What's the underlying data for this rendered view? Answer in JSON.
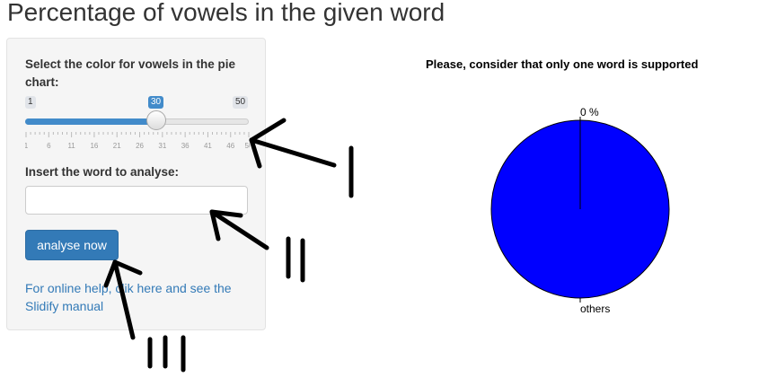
{
  "page": {
    "title": "Percentage of vowels in the given word"
  },
  "sidebar": {
    "color_label": "Select the color for vowels in the pie chart:",
    "slider": {
      "min": "1",
      "max": "50",
      "value": "30",
      "tick_labels": [
        "1",
        "6",
        "11",
        "16",
        "21",
        "26",
        "31",
        "36",
        "41",
        "46",
        "50"
      ]
    },
    "word_label": "Insert the word to analyse:",
    "word_input": {
      "value": "",
      "placeholder": ""
    },
    "analyse_button": "analyse now",
    "help_text": "For online help, clik here and see the Slidify manual"
  },
  "chart": {
    "title": "Please, consider that only one word is supported",
    "slice_top_label": "0 %",
    "slice_bottom_label": "others",
    "fill_color": "#0000ff"
  },
  "chart_data": {
    "type": "pie",
    "title": "Please, consider that only one word is supported",
    "labels": [
      "0 %",
      "others"
    ],
    "values": [
      0,
      100
    ],
    "colors": [
      "#0000ff",
      "#0000ff"
    ]
  },
  "annotations": {
    "arrow_labels": [
      "I",
      "II",
      "III"
    ]
  }
}
